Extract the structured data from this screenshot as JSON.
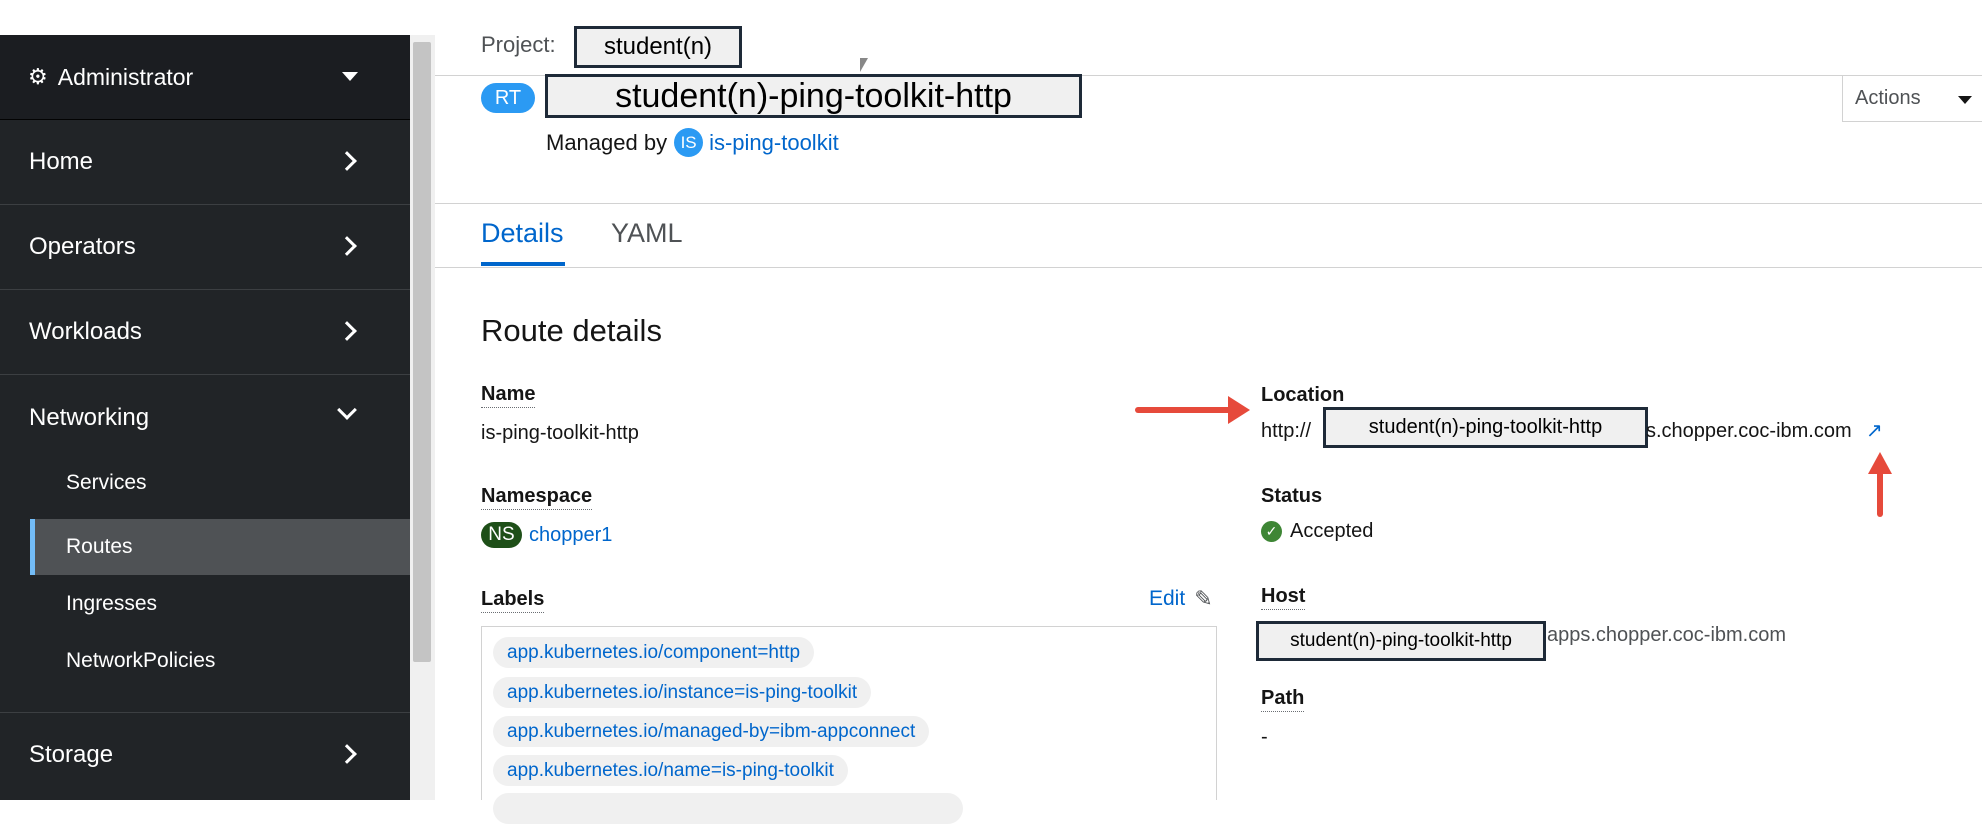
{
  "sidebar": {
    "perspective": "Administrator",
    "sections": {
      "home": "Home",
      "operators": "Operators",
      "workloads": "Workloads",
      "networking": "Networking",
      "storage": "Storage"
    },
    "networking_items": [
      "Services",
      "Routes",
      "Ingresses",
      "NetworkPolicies"
    ]
  },
  "header": {
    "project_label": "Project:",
    "project_name": "student(n)",
    "resource_badge": "RT",
    "title": "student(n)-ping-toolkit-http",
    "managed_by_label": "Managed by",
    "managed_by_badge": "IS",
    "managed_by_link": "is-ping-toolkit",
    "actions_label": "Actions"
  },
  "tabs": [
    "Details",
    "YAML"
  ],
  "details": {
    "heading": "Route details",
    "name_label": "Name",
    "name_value": "is-ping-toolkit-http",
    "namespace_label": "Namespace",
    "namespace_badge": "NS",
    "namespace_value": "chopper1",
    "labels_label": "Labels",
    "edit_label": "Edit",
    "labels": [
      "app.kubernetes.io/component=http",
      "app.kubernetes.io/instance=is-ping-toolkit",
      "app.kubernetes.io/managed-by=ibm-appconnect",
      "app.kubernetes.io/name=is-ping-toolkit"
    ],
    "location_label": "Location",
    "location_prefix": "http://",
    "location_redacted": "student(n)-ping-toolkit-http",
    "location_suffix": "s.chopper.coc-ibm.com",
    "status_label": "Status",
    "status_value": "Accepted",
    "host_label": "Host",
    "host_redacted": "student(n)-ping-toolkit-http",
    "host_suffix": "apps.chopper.coc-ibm.com",
    "path_label": "Path",
    "path_value": "-"
  },
  "colors": {
    "sidebar_bg": "#212427",
    "link": "#0066cc",
    "annotation_arrow": "#e64a3b",
    "status_ok": "#3e8635",
    "namespace_badge": "#1e4f18"
  }
}
